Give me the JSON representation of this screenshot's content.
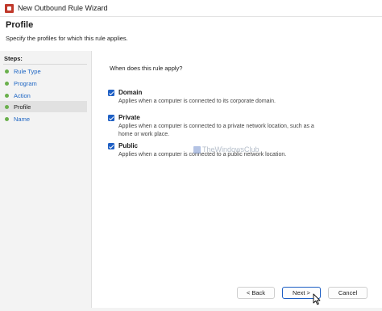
{
  "window": {
    "title": "New Outbound Rule Wizard"
  },
  "header": {
    "heading": "Profile",
    "subheading": "Specify the profiles for which this rule applies."
  },
  "steps": {
    "label": "Steps:",
    "items": [
      {
        "label": "Rule Type"
      },
      {
        "label": "Program"
      },
      {
        "label": "Action"
      },
      {
        "label": "Profile"
      },
      {
        "label": "Name"
      }
    ]
  },
  "main": {
    "question": "When does this rule apply?",
    "options": [
      {
        "label": "Domain",
        "checked": true,
        "description": "Applies when a computer is connected to its corporate domain."
      },
      {
        "label": "Private",
        "checked": true,
        "description": "Applies when a computer is connected to a private network location, such as a home or work place."
      },
      {
        "label": "Public",
        "checked": true,
        "description": "Applies when a computer is connected to a public network location."
      }
    ],
    "watermark": "TheWindowsClub"
  },
  "buttons": {
    "back": "< Back",
    "next": "Next >",
    "cancel": "Cancel"
  },
  "colors": {
    "accent": "#1e5fc4",
    "step_bullet": "#6ab04c",
    "step_link": "#1e66c4"
  }
}
